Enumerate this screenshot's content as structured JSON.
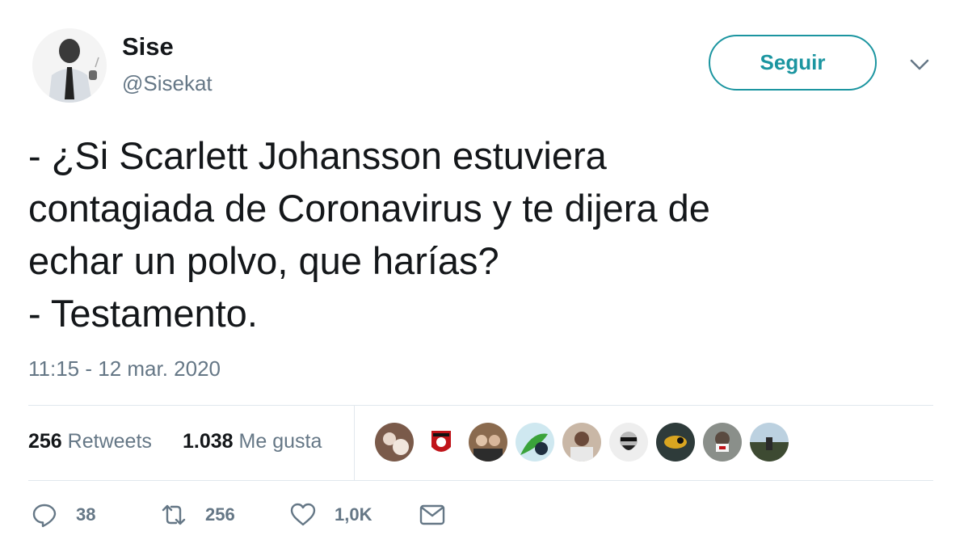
{
  "author": {
    "name": "Sise",
    "handle": "@Sisekat"
  },
  "follow_label": "Seguir",
  "tweet": {
    "text": "- ¿Si Scarlett Johansson estuviera\ncontagiada de Coronavirus y te dijera de\nechar un polvo, que harías?\n- Testamento.",
    "timestamp": "11:15 - 12 mar. 2020"
  },
  "stats": {
    "retweets_count": "256",
    "retweets_label": "Retweets",
    "likes_count": "1.038",
    "likes_label": "Me gusta"
  },
  "liker_avatars": [
    "avatar-1",
    "avatar-2",
    "avatar-3",
    "avatar-4",
    "avatar-5",
    "avatar-6",
    "avatar-7",
    "avatar-8",
    "avatar-9"
  ],
  "actions": {
    "replies": "38",
    "retweets": "256",
    "likes": "1,0K"
  },
  "colors": {
    "accent": "#1b95a0",
    "secondary_text": "#657786",
    "divider": "#e1e8ed"
  }
}
